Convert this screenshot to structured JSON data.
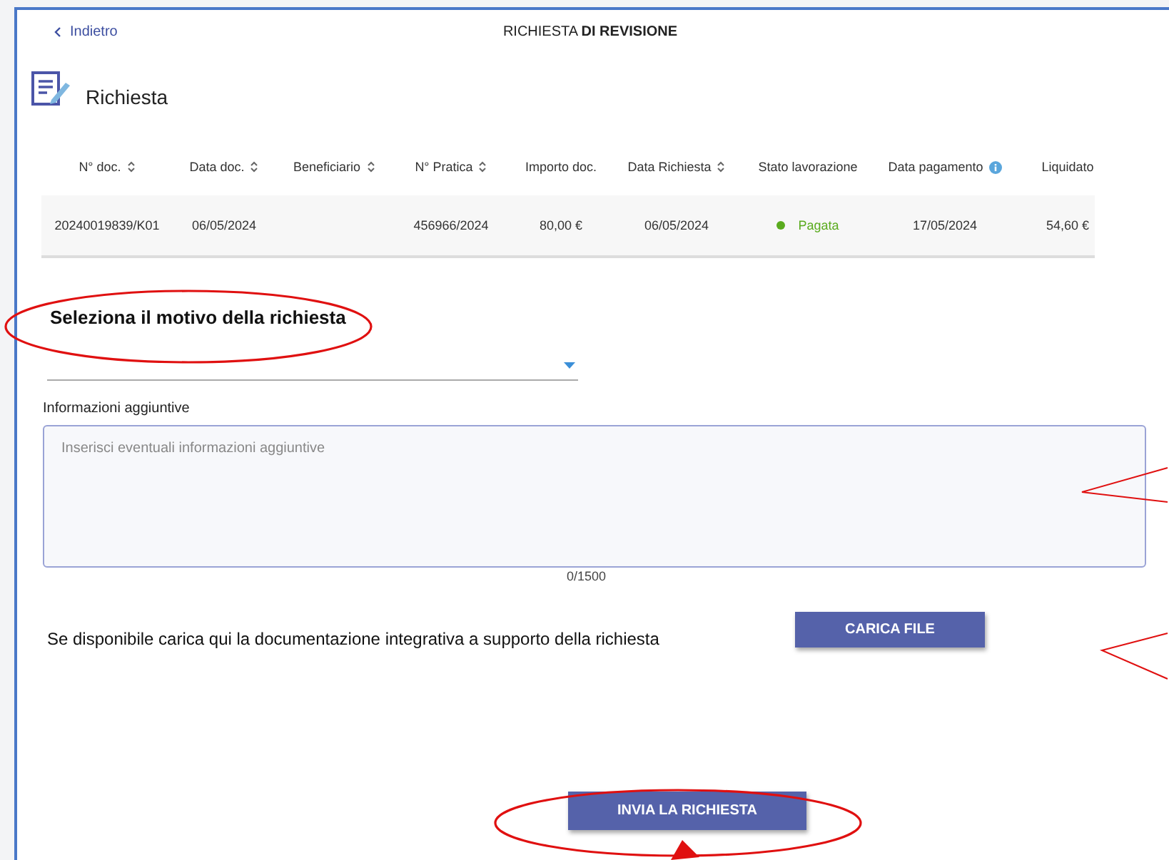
{
  "header": {
    "back_link": "Indietro",
    "title": "RICHIESTA **DI REVISIONE**"
  },
  "section": {
    "title": "Richiesta"
  },
  "table": {
    "columns": [
      {
        "label": "N° doc.",
        "sortable": true,
        "info": false
      },
      {
        "label": "Data doc.",
        "sortable": true,
        "info": false
      },
      {
        "label": "Beneficiario",
        "sortable": true,
        "info": false
      },
      {
        "label": "N° Pratica",
        "sortable": true,
        "info": false
      },
      {
        "label": "Importo doc.",
        "sortable": false,
        "info": false
      },
      {
        "label": "Data Richiesta",
        "sortable": true,
        "info": false
      },
      {
        "label": "Stato lavorazione",
        "sortable": false,
        "info": false
      },
      {
        "label": "Data pagamento",
        "sortable": false,
        "info": true
      },
      {
        "label": "Liquidato",
        "sortable": false,
        "info": false
      }
    ],
    "rows": [
      {
        "doc": "20240019839/K01",
        "data_doc": "06/05/2024",
        "pratica": "456966/2024",
        "importo": "80,00 €",
        "data_richiesta": "06/05/2024",
        "stato": {
          "label": "Pagata",
          "color": "#5aab1e"
        },
        "data_pagamento": "17/05/2024",
        "liquidato": "54,60 €"
      }
    ]
  },
  "form": {
    "reason_title": "Seleziona il motivo della richiesta",
    "info_label": "Informazioni aggiuntive",
    "info_placeholder": "Inserisci eventuali informazioni aggiuntive",
    "counter": "0/1500",
    "upload_text": "Se disponibile carica qui la documentazione integrativa a supporto della richiesta",
    "upload_button": "CARICA FILE",
    "submit_button": "INVIA LA RICHIESTA"
  }
}
